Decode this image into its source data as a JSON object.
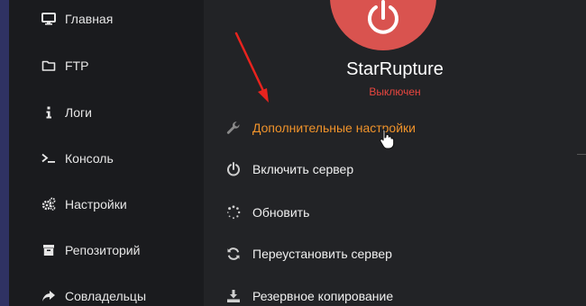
{
  "sidebar": {
    "items": [
      {
        "label": "Главная",
        "icon": "monitor-icon"
      },
      {
        "label": "FTP",
        "icon": "folder-icon"
      },
      {
        "label": "Логи",
        "icon": "info-icon"
      },
      {
        "label": "Консоль",
        "icon": "terminal-icon"
      },
      {
        "label": "Настройки",
        "icon": "cogs-icon"
      },
      {
        "label": "Репозиторий",
        "icon": "archive-icon"
      },
      {
        "label": "Совладельцы",
        "icon": "share-icon"
      }
    ]
  },
  "server": {
    "name": "StarRupture",
    "status": "Выключен"
  },
  "actions": [
    {
      "label": "Дополнительные настройки",
      "icon": "wrench-icon"
    },
    {
      "label": "Включить сервер",
      "icon": "power-icon"
    },
    {
      "label": "Обновить",
      "icon": "spinner-icon"
    },
    {
      "label": "Переустановить сервер",
      "icon": "refresh-icon"
    },
    {
      "label": "Резервное копирование",
      "icon": "download-icon"
    }
  ],
  "colors": {
    "accent": "#f0932b",
    "status_off": "#e8463f",
    "power_button": "#d9534f",
    "arrow": "#e8231e"
  }
}
